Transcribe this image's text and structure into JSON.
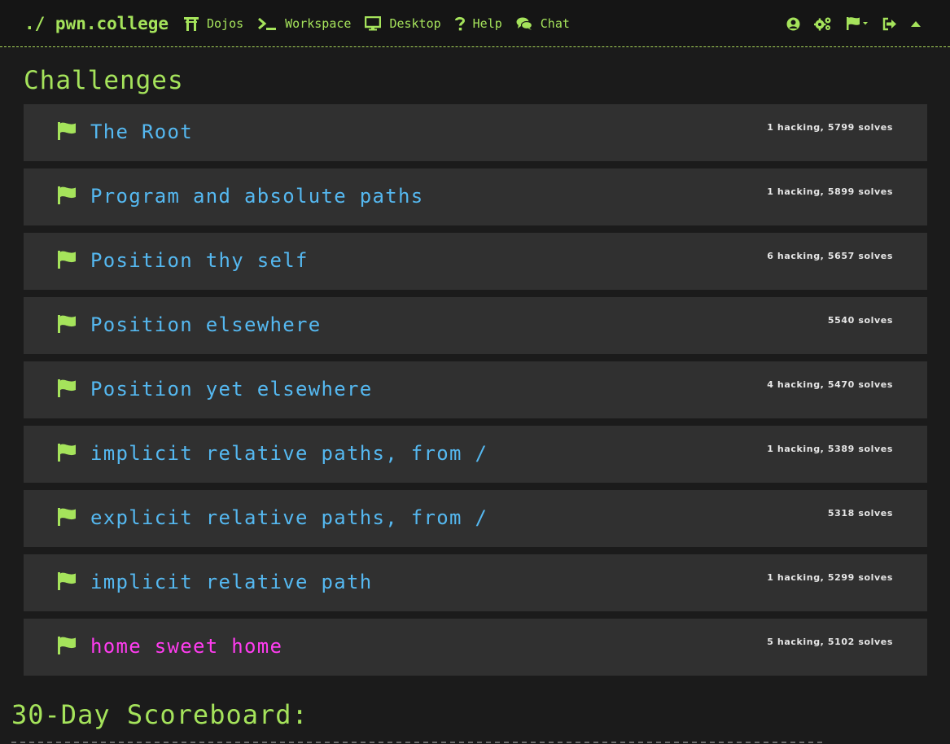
{
  "navbar": {
    "brand": "./ pwn.college",
    "links": [
      {
        "label": "Dojos",
        "icon": "torii-icon"
      },
      {
        "label": "Workspace",
        "icon": "terminal-icon"
      },
      {
        "label": "Desktop",
        "icon": "monitor-icon"
      },
      {
        "label": "Help",
        "icon": "question-icon"
      },
      {
        "label": "Chat",
        "icon": "chat-icon"
      }
    ],
    "right_icons": [
      "user-circle-icon",
      "cogs-icon",
      "flag-dropdown-icon",
      "logout-icon",
      "caret-up-icon"
    ]
  },
  "page": {
    "title": "Challenges",
    "scoreboard_title": "30-Day Scoreboard:"
  },
  "challenges": [
    {
      "title": "The Root",
      "stats": "1 hacking, 5799 solves",
      "active": false
    },
    {
      "title": "Program and absolute paths",
      "stats": "1 hacking, 5899 solves",
      "active": false
    },
    {
      "title": "Position thy self",
      "stats": "6 hacking, 5657 solves",
      "active": false
    },
    {
      "title": "Position elsewhere",
      "stats": "5540 solves",
      "active": false
    },
    {
      "title": "Position yet elsewhere",
      "stats": "4 hacking, 5470 solves",
      "active": false
    },
    {
      "title": "implicit relative paths, from /",
      "stats": "1 hacking, 5389 solves",
      "active": false
    },
    {
      "title": "explicit relative paths, from /",
      "stats": "5318 solves",
      "active": false
    },
    {
      "title": "implicit relative path",
      "stats": "1 hacking, 5299 solves",
      "active": false
    },
    {
      "title": "home sweet home",
      "stats": "5 hacking, 5102 solves",
      "active": true
    }
  ],
  "colors": {
    "accent_green": "#a5e35b",
    "title_blue": "#55b8f0",
    "active_magenta": "#ff3cf0",
    "card_bg": "#303030",
    "page_bg": "#1b1b1b"
  }
}
